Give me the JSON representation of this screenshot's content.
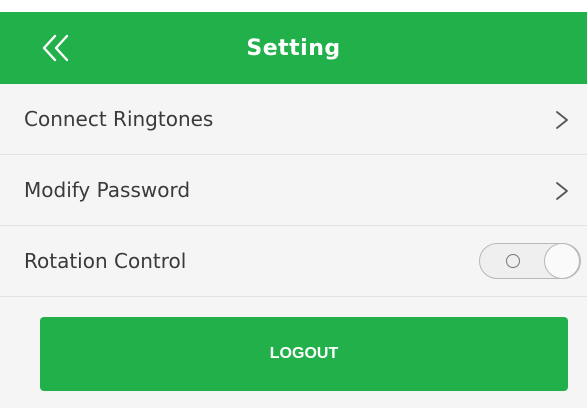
{
  "header": {
    "title": "Setting",
    "back_icon": "double-chevron-left-icon"
  },
  "settings": [
    {
      "label": "Connect Ringtones",
      "control": "chevron-right-icon"
    },
    {
      "label": "Modify Password",
      "control": "chevron-right-icon"
    },
    {
      "label": "Rotation Control",
      "control": "toggle",
      "state": "off"
    }
  ],
  "logout_label": "LOGOUT",
  "colors": {
    "accent": "#22b04b",
    "background": "#f5f5f5"
  }
}
